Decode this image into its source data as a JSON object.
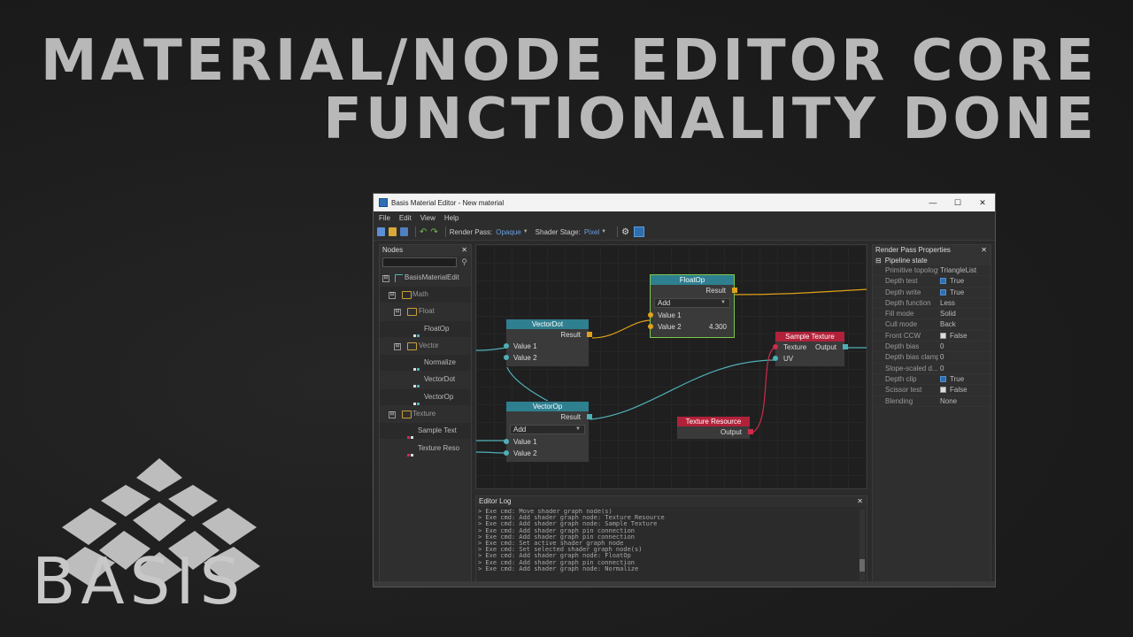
{
  "headline": {
    "line1": "MATERIAL/NODE EDITOR CORE",
    "line2": "FUNCTIONALITY DONE"
  },
  "brand": {
    "logo_text": "BASIS"
  },
  "window": {
    "title": "Basis Material Editor - New material",
    "controls": {
      "minimize": "—",
      "maximize": "☐",
      "close": "✕"
    }
  },
  "menu": [
    "File",
    "Edit",
    "View",
    "Help"
  ],
  "toolbar": {
    "render_pass_label": "Render Pass:",
    "render_pass_value": "Opaque",
    "shader_stage_label": "Shader Stage:",
    "shader_stage_value": "Pixel",
    "caret": "▼"
  },
  "nodes_panel": {
    "title": "Nodes",
    "close": "✕",
    "search_icon": "⚲",
    "tree": [
      {
        "label": "BasisMaterialEdit",
        "kind": "root",
        "expander": "⊟"
      },
      {
        "label": "Math",
        "kind": "folder",
        "expander": "⊟"
      },
      {
        "label": "Float",
        "kind": "folder",
        "expander": "⊟"
      },
      {
        "label": "FloatOp",
        "kind": "leaf"
      },
      {
        "label": "Vector",
        "kind": "folder",
        "expander": "⊟"
      },
      {
        "label": "Normalize",
        "kind": "leaf"
      },
      {
        "label": "VectorDot",
        "kind": "leaf"
      },
      {
        "label": "VectorOp",
        "kind": "leaf"
      },
      {
        "label": "Texture",
        "kind": "folder",
        "expander": "⊟"
      },
      {
        "label": "Sample Text",
        "kind": "leaf-red"
      },
      {
        "label": "Texture Reso",
        "kind": "leaf-red"
      }
    ]
  },
  "graph": {
    "nodes": {
      "floatop": {
        "title": "FloatOp",
        "result": "Result",
        "op": "Add",
        "in1": "Value 1",
        "in2": "Value 2",
        "in2_value": "4.300"
      },
      "vectordot": {
        "title": "VectorDot",
        "result": "Result",
        "in1": "Value 1",
        "in2": "Value 2"
      },
      "sampletex": {
        "title": "Sample Texture",
        "in_tex": "Texture",
        "out": "Output",
        "in_uv": "UV"
      },
      "vectorop": {
        "title": "VectorOp",
        "result": "Result",
        "op": "Add",
        "in1": "Value 1",
        "in2": "Value 2"
      },
      "texres": {
        "title": "Texture Resource",
        "out": "Output"
      }
    },
    "colors": {
      "float_pin": "#e0a21a",
      "vector_pin": "#4fb0b8",
      "texture_pin": "#d02a4a",
      "selected_border": "#7cc94b"
    }
  },
  "log": {
    "title": "Editor Log",
    "close": "✕",
    "lines": [
      "> Exe cmd: Move shader graph node(s)",
      "> Exe cmd: Add shader graph node: Texture Resource",
      "> Exe cmd: Add shader graph node: Sample Texture",
      "> Exe cmd: Add shader graph pin connection",
      "> Exe cmd: Add shader graph pin connection",
      "> Exe cmd: Set active shader graph node",
      "> Exe cmd: Set selected shader graph node(s)",
      "> Exe cmd: Add shader graph node: FloatOp",
      "> Exe cmd: Add shader graph pin connection",
      "> Exe cmd: Add shader graph node: Normalize"
    ]
  },
  "properties": {
    "title": "Render Pass Properties",
    "close": "✕",
    "category": "Pipeline state",
    "category_expander": "⊟",
    "rows": [
      {
        "key": "Primitive topology",
        "value": "TriangleList"
      },
      {
        "key": "Depth test",
        "value": "True",
        "check": "on"
      },
      {
        "key": "Depth write",
        "value": "True",
        "check": "on"
      },
      {
        "key": "Depth function",
        "value": "Less"
      },
      {
        "key": "Fill mode",
        "value": "Solid"
      },
      {
        "key": "Cull mode",
        "value": "Back"
      },
      {
        "key": "Front CCW",
        "value": "False",
        "check": "off"
      },
      {
        "key": "Depth bias",
        "value": "0"
      },
      {
        "key": "Depth bias clamp",
        "value": "0"
      },
      {
        "key": "Slope-scaled d...",
        "value": "0"
      },
      {
        "key": "Depth clip",
        "value": "True",
        "check": "on"
      },
      {
        "key": "Scissor test",
        "value": "False",
        "check": "off"
      },
      {
        "key": "Blending",
        "value": "None"
      }
    ]
  }
}
